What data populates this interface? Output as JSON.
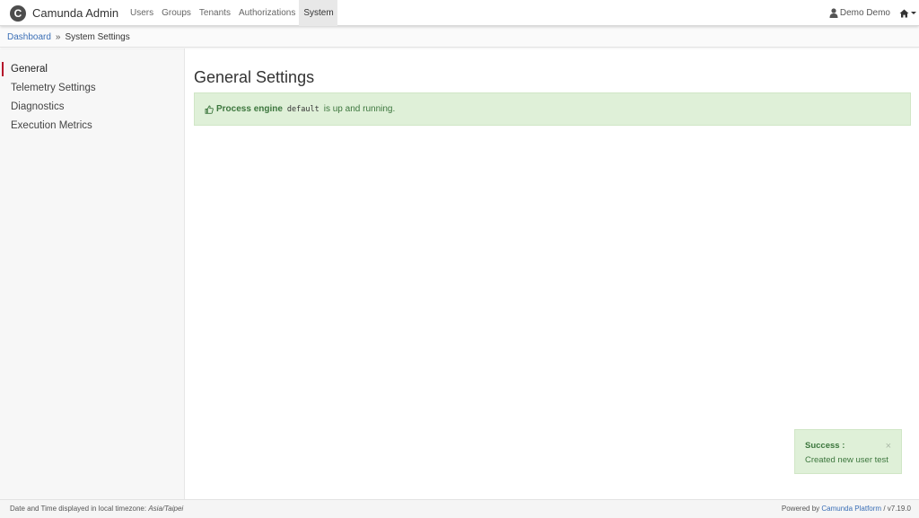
{
  "navbar": {
    "brand_logo_letter": "C",
    "brand_name": "Camunda Admin",
    "links": [
      {
        "label": "Users"
      },
      {
        "label": "Groups"
      },
      {
        "label": "Tenants"
      },
      {
        "label": "Authorizations"
      },
      {
        "label": "System"
      }
    ],
    "active_link": "System",
    "user_name": "Demo Demo",
    "icons": {
      "user": "user-icon",
      "home": "home-icon",
      "caret": "caret-down-icon"
    }
  },
  "breadcrumb": {
    "root": "Dashboard",
    "separator": "»",
    "current": "System Settings"
  },
  "sidebar": {
    "items": [
      {
        "label": "General",
        "active": true
      },
      {
        "label": "Telemetry Settings"
      },
      {
        "label": "Diagnostics"
      },
      {
        "label": "Execution Metrics"
      }
    ],
    "active_color": "#b5152b"
  },
  "main": {
    "title": "General Settings",
    "status": {
      "icon": "thumbs-up-icon",
      "strong": "Process engine",
      "engine_name": "default",
      "text": "is up and running."
    }
  },
  "toast": {
    "title": "Success :",
    "message": "Created new user test",
    "close": "×"
  },
  "footer": {
    "tz_prefix": "Date and Time displayed in local timezone:",
    "tz": "Asia/Taipei",
    "powered_prefix": "Powered by",
    "platform": "Camunda Platform",
    "version": "/ v7.19.0"
  },
  "colors": {
    "link": "#3b6fb6",
    "success_bg": "#dff0d8",
    "success_text": "#3c763d",
    "nav_active_bg": "#e8e8e8"
  }
}
